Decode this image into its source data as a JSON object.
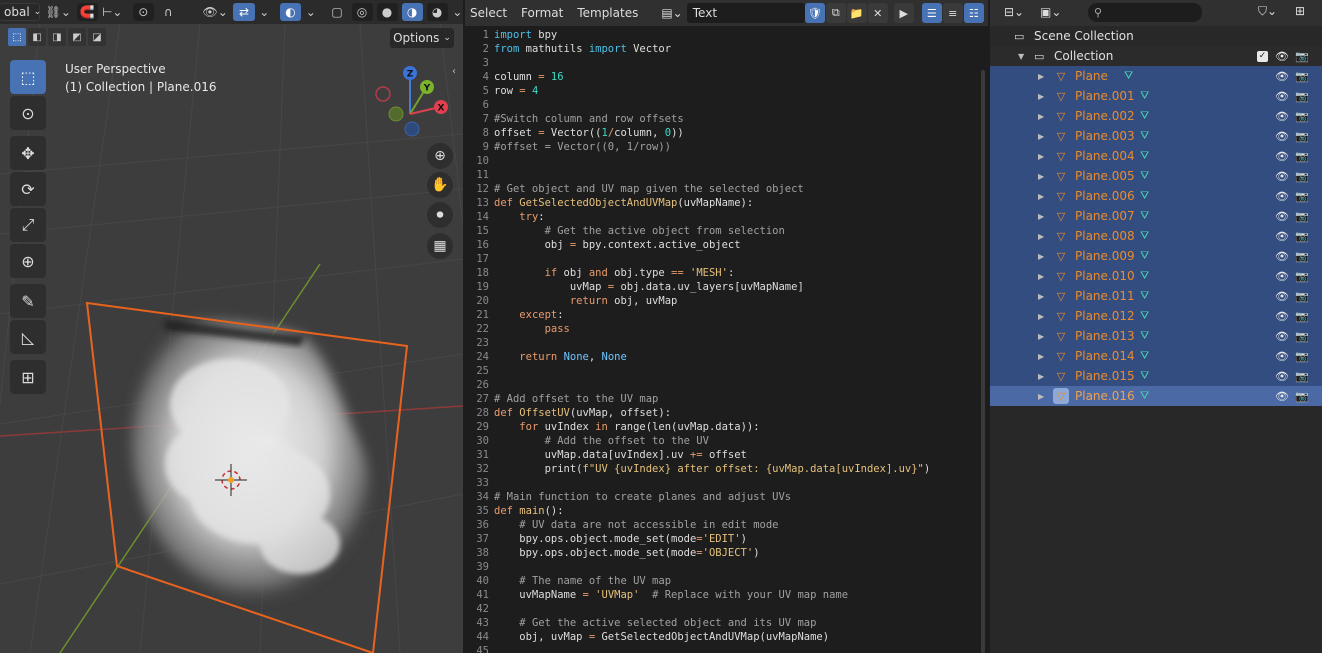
{
  "viewport": {
    "header": {
      "orientation_label": "obal",
      "snapping_label": "⌑"
    },
    "options_label": "Options",
    "title_line1": "User Perspective",
    "title_line2": "(1) Collection | Plane.016",
    "gizmo": {
      "z": "Z",
      "y": "Y",
      "x": "X"
    },
    "tools": [
      {
        "name": "select-box-tool",
        "glyph": "⬚",
        "active": true
      },
      {
        "name": "cursor-tool",
        "glyph": "⊙"
      },
      {
        "name": "move-tool",
        "glyph": "✥"
      },
      {
        "name": "rotate-tool",
        "glyph": "⟳"
      },
      {
        "name": "scale-tool",
        "glyph": "⤢"
      },
      {
        "name": "transform-tool",
        "glyph": "⊕"
      },
      {
        "name": "annotate-tool",
        "glyph": "✎"
      },
      {
        "name": "measure-tool",
        "glyph": "📐"
      },
      {
        "name": "add-cube-tool",
        "glyph": "⊞"
      }
    ]
  },
  "editor": {
    "menu": [
      "Select",
      "Format",
      "Templates"
    ],
    "text_name": "Text",
    "line_numbers": [
      "1",
      "2",
      "3",
      "4",
      "5",
      "6",
      "7",
      "8",
      "9",
      "10",
      "11",
      "12",
      "13",
      "14",
      "15",
      "16",
      "17",
      "18",
      "19",
      "20",
      "21",
      "22",
      "23",
      "24",
      "25",
      "26",
      "27",
      "28",
      "29",
      "30",
      "31",
      "32",
      "33",
      "34",
      "35",
      "36",
      "37",
      "38",
      "39",
      "40",
      "41",
      "42",
      "43",
      "44",
      "45"
    ]
  },
  "outliner": {
    "search_placeholder": "",
    "scene_collection_label": "Scene Collection",
    "collection_label": "Collection",
    "objects": [
      "Plane",
      "Plane.001",
      "Plane.002",
      "Plane.003",
      "Plane.004",
      "Plane.005",
      "Plane.006",
      "Plane.007",
      "Plane.008",
      "Plane.009",
      "Plane.010",
      "Plane.011",
      "Plane.012",
      "Plane.013",
      "Plane.014",
      "Plane.015",
      "Plane.016"
    ],
    "active_object": "Plane.016"
  },
  "colors": {
    "accent": "#4772b3",
    "selected_row": "#334d80",
    "object_orange": "#e98b2c",
    "mesh_teal": "#45d6b1",
    "plane_outline": "#e8631e"
  }
}
